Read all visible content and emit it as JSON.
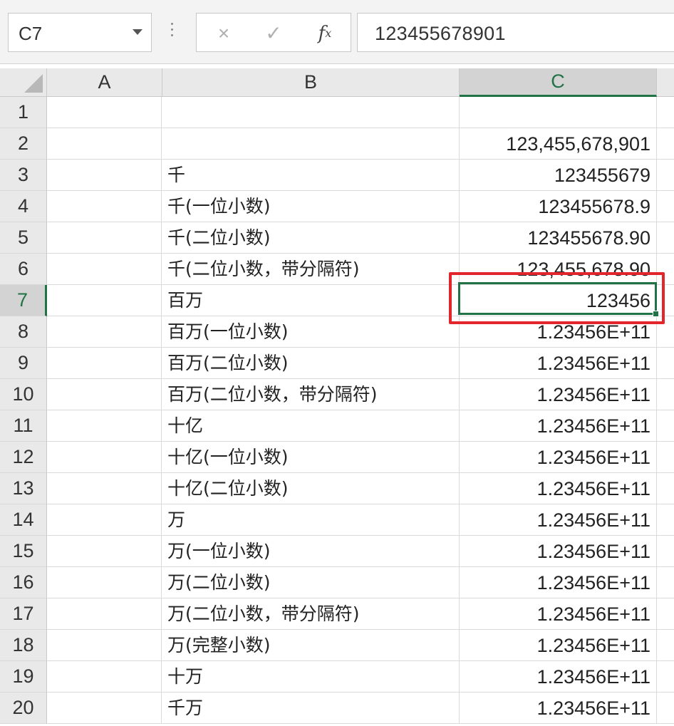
{
  "formula_bar": {
    "name_box": "C7",
    "cancel_icon": "×",
    "enter_icon": "✓",
    "fx_label": "f",
    "fx_sub": "x",
    "formula_value": "123455678901"
  },
  "columns": [
    "A",
    "B",
    "C"
  ],
  "selected_cell": "C7",
  "rows": [
    {
      "num": "1",
      "b": "",
      "c": ""
    },
    {
      "num": "2",
      "b": "",
      "c": "123,455,678,901"
    },
    {
      "num": "3",
      "b": "千",
      "c": "123455679"
    },
    {
      "num": "4",
      "b": "千(一位小数)",
      "c": "123455678.9"
    },
    {
      "num": "5",
      "b": "千(二位小数)",
      "c": "123455678.90"
    },
    {
      "num": "6",
      "b": "千(二位小数，带分隔符)",
      "c": "123,455,678.90"
    },
    {
      "num": "7",
      "b": "百万",
      "c": "123456"
    },
    {
      "num": "8",
      "b": "百万(一位小数)",
      "c": "1.23456E+11"
    },
    {
      "num": "9",
      "b": "百万(二位小数)",
      "c": "1.23456E+11"
    },
    {
      "num": "10",
      "b": "百万(二位小数，带分隔符)",
      "c": "1.23456E+11"
    },
    {
      "num": "11",
      "b": "十亿",
      "c": "1.23456E+11"
    },
    {
      "num": "12",
      "b": "十亿(一位小数)",
      "c": "1.23456E+11"
    },
    {
      "num": "13",
      "b": "十亿(二位小数)",
      "c": "1.23456E+11"
    },
    {
      "num": "14",
      "b": "万",
      "c": "1.23456E+11"
    },
    {
      "num": "15",
      "b": "万(一位小数)",
      "c": "1.23456E+11"
    },
    {
      "num": "16",
      "b": "万(二位小数)",
      "c": "1.23456E+11"
    },
    {
      "num": "17",
      "b": "万(二位小数，带分隔符)",
      "c": "1.23456E+11"
    },
    {
      "num": "18",
      "b": "万(完整小数)",
      "c": "1.23456E+11"
    },
    {
      "num": "19",
      "b": "十万",
      "c": "1.23456E+11"
    },
    {
      "num": "20",
      "b": "千万",
      "c": "1.23456E+11"
    }
  ],
  "colors": {
    "selection": "#217346",
    "highlight": "#e2262b"
  }
}
